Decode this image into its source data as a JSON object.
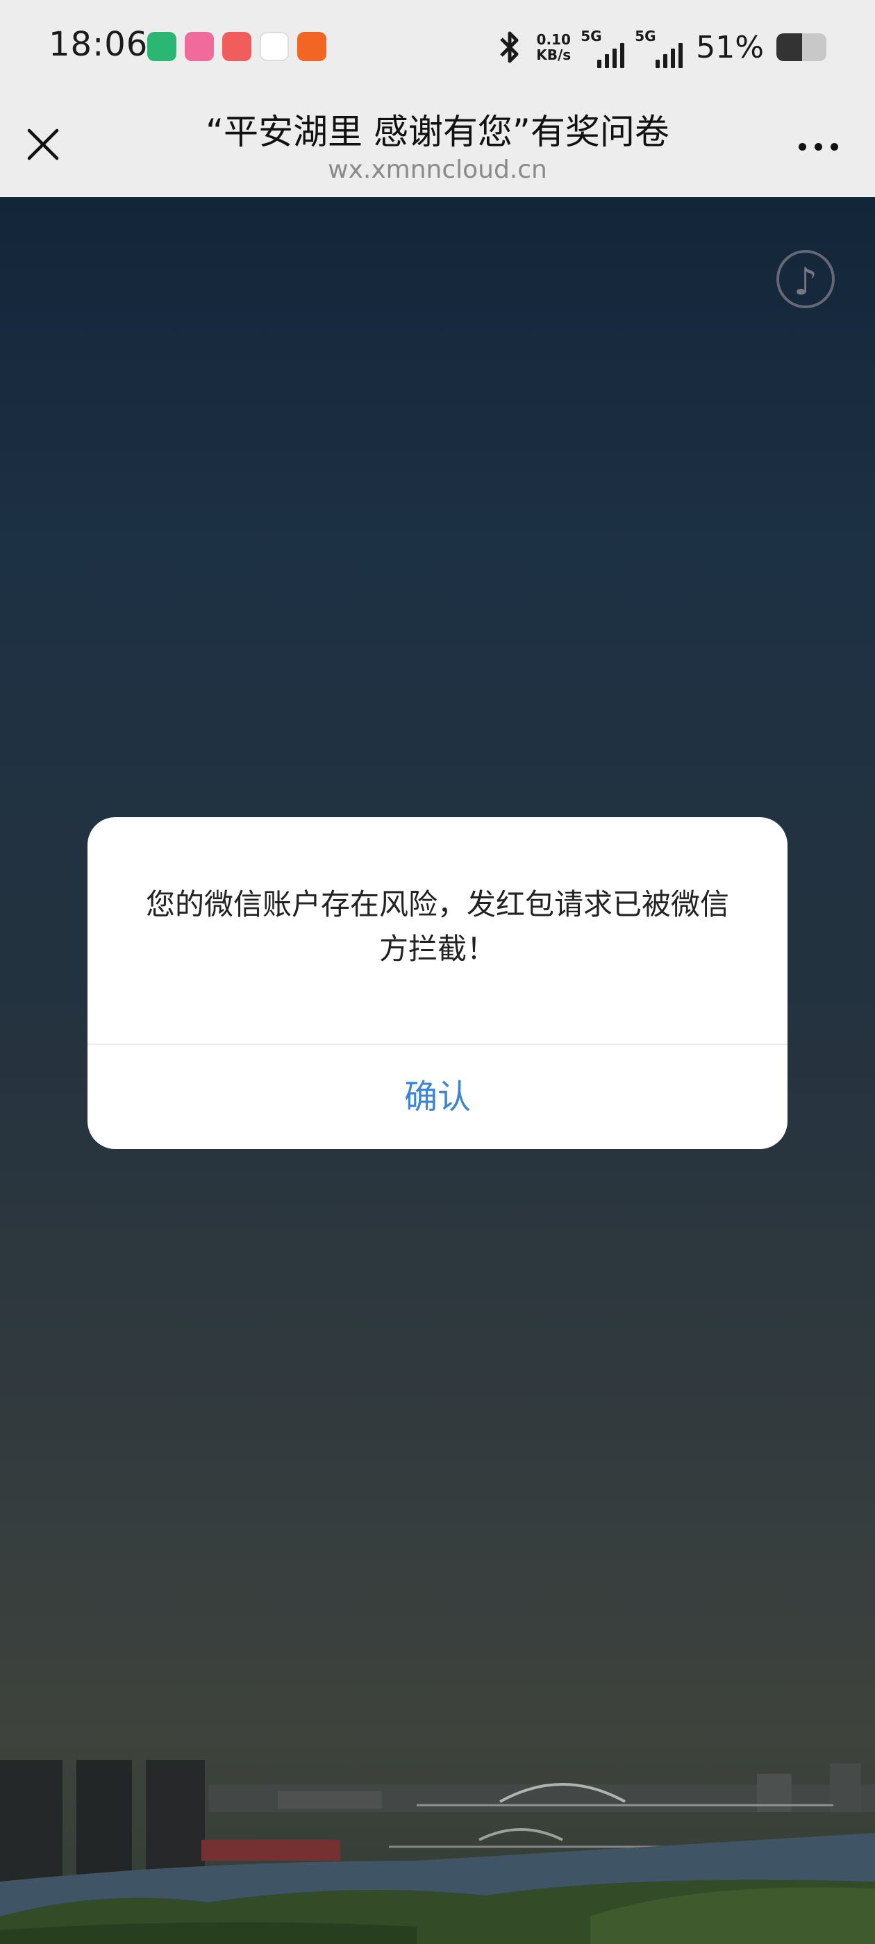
{
  "status_bar": {
    "time": "18:06",
    "net_speed_value": "0.10",
    "net_speed_unit": "KB/s",
    "sim1_label": "5G",
    "sim2_label": "5G",
    "battery_percent": "51%",
    "battery_level": 0.51,
    "notification_icons": [
      "mi-home-icon",
      "bilibili-icon",
      "app-mascot-icon",
      "app-logo-icon",
      "paper-plane-icon"
    ],
    "icon_colors": [
      "#2bb673",
      "#f06a9c",
      "#f15c5c",
      "#e94040",
      "#f26522"
    ]
  },
  "browser": {
    "title": "“平安湖里 感谢有您”有奖问卷",
    "url": "wx.xmnncloud.cn",
    "close_icon": "close-icon",
    "more_icon": "more-icon"
  },
  "page": {
    "music_icon": "♪"
  },
  "dialog": {
    "message": "您的微信账户存在风险，发红包请求已被微信方拦截！",
    "confirm_label": "确认",
    "confirm_color": "#3a85d6"
  }
}
